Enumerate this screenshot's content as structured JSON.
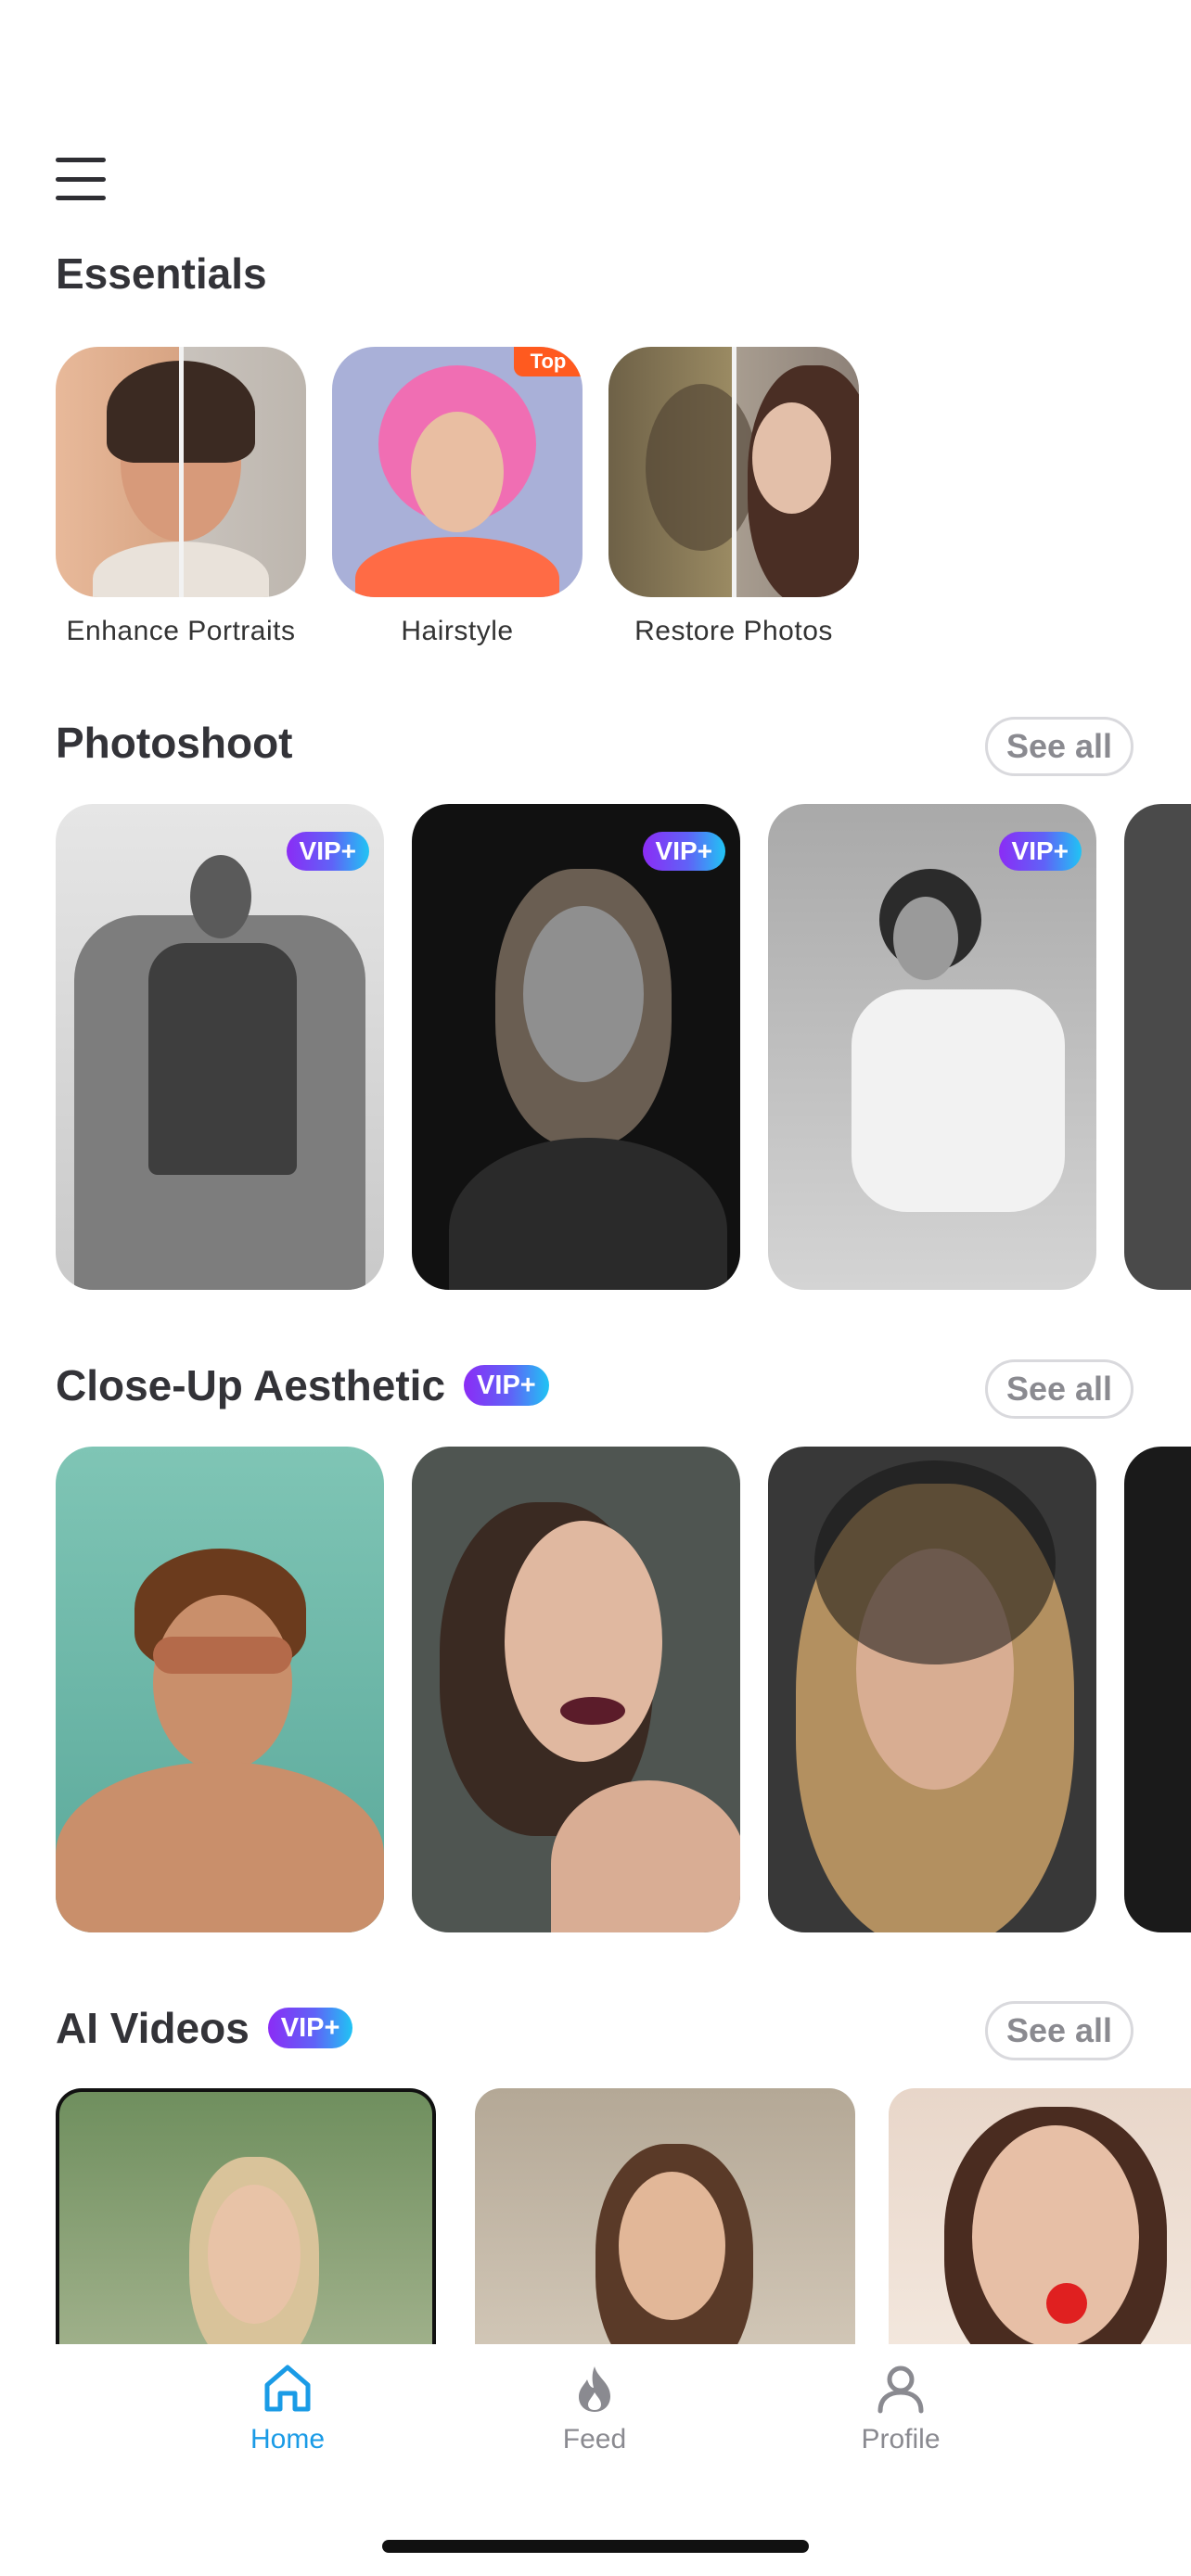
{
  "essentials": {
    "title": "Essentials",
    "items": [
      {
        "label": "Enhance Portraits",
        "badge": ""
      },
      {
        "label": "Hairstyle",
        "badge": "Top"
      },
      {
        "label": "Restore Photos",
        "badge": ""
      }
    ]
  },
  "photoshoot": {
    "title": "Photoshoot",
    "see_all": "See all",
    "vip_badge": "VIP+"
  },
  "closeup": {
    "title": "Close-Up Aesthetic",
    "vip_badge": "VIP+",
    "see_all": "See all"
  },
  "ai_videos": {
    "title": "AI Videos",
    "vip_badge": "VIP+",
    "see_all": "See all"
  },
  "tabbar": {
    "tabs": [
      {
        "label": "Home",
        "icon": "home-icon",
        "active": true
      },
      {
        "label": "Feed",
        "icon": "flame-icon",
        "active": false
      },
      {
        "label": "Profile",
        "icon": "person-icon",
        "active": false
      }
    ],
    "active_color": "#1a9be6",
    "inactive_color": "#8a8a90"
  }
}
